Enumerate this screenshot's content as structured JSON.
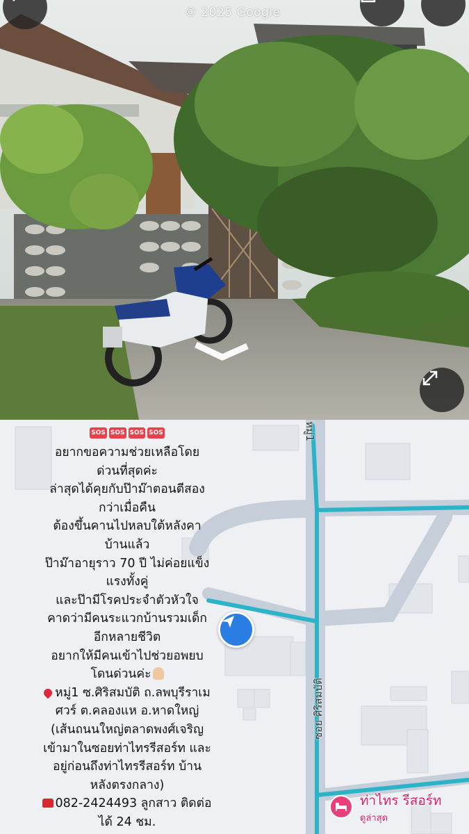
{
  "street_view": {
    "watermark": "© 2025 Google",
    "controls": {
      "back_icon": "chevron-left-icon",
      "share_icon": "share-icon",
      "more_icon": "more-icon",
      "expand_icon": "expand-icon"
    }
  },
  "post": {
    "sos_badges": [
      "SOS",
      "SOS",
      "SOS",
      "SOS"
    ],
    "lines": [
      "อยากขอความช่วยเหลือโดย",
      "ด่วนที่สุดค่ะ",
      "ล่าสุดได้คุยกับป๊าม๊าตอนตีสอง",
      "กว่าเมื่อคืน",
      "ต้องขึ้นคานไปหลบใต้หลังคา",
      "บ้านแล้ว",
      "ป๊าม๊าอายุราว 70 ปี ไม่ค่อยแข็ง",
      "แรงทั้งคู่",
      "และป๊ามีโรคประจำตัวหัวใจ",
      "คาดว่ามีคนระแวกบ้านรวมเด็ก",
      "อีกหลายชีวิต",
      "อยากให้มีคนเข้าไปช่วยอพยบ",
      "โดนด่วนค่ะ"
    ],
    "address_lines": [
      "หมู่1 ซ.ศิริสมบัติ ถ.ลพบุรีราเม",
      "ศวร์ ต.คลองแห อ.หาดใหญ่",
      "(เส้นถนนใหญ่ตลาดพงศ์เจริญ",
      "เข้ามาในซอยท่าไทรรีสอร์ท และ",
      "อยู่ก่อนถึงท่าไทรรีสอร์ท บ้าน",
      "หลังตรงกลาง)"
    ],
    "phone_line": "082-2424493 ลูกสาว ติดต่อ",
    "phone_line_2": "ได้ 24 ชม."
  },
  "map": {
    "street_top_label": "หมู่1",
    "street_side_label": "ซอย ศิริสมบัติ",
    "place_name": "ท่าไทร รีสอร์ท",
    "place_sub": "ดูล่าสุด",
    "place_icon": "bed-icon",
    "nav_icon": "navigation-arrow-icon",
    "colors": {
      "road": "#c6ced9",
      "route": "#2bb3c8",
      "place": "#d61f6a",
      "nav": "#2a7de1"
    }
  }
}
